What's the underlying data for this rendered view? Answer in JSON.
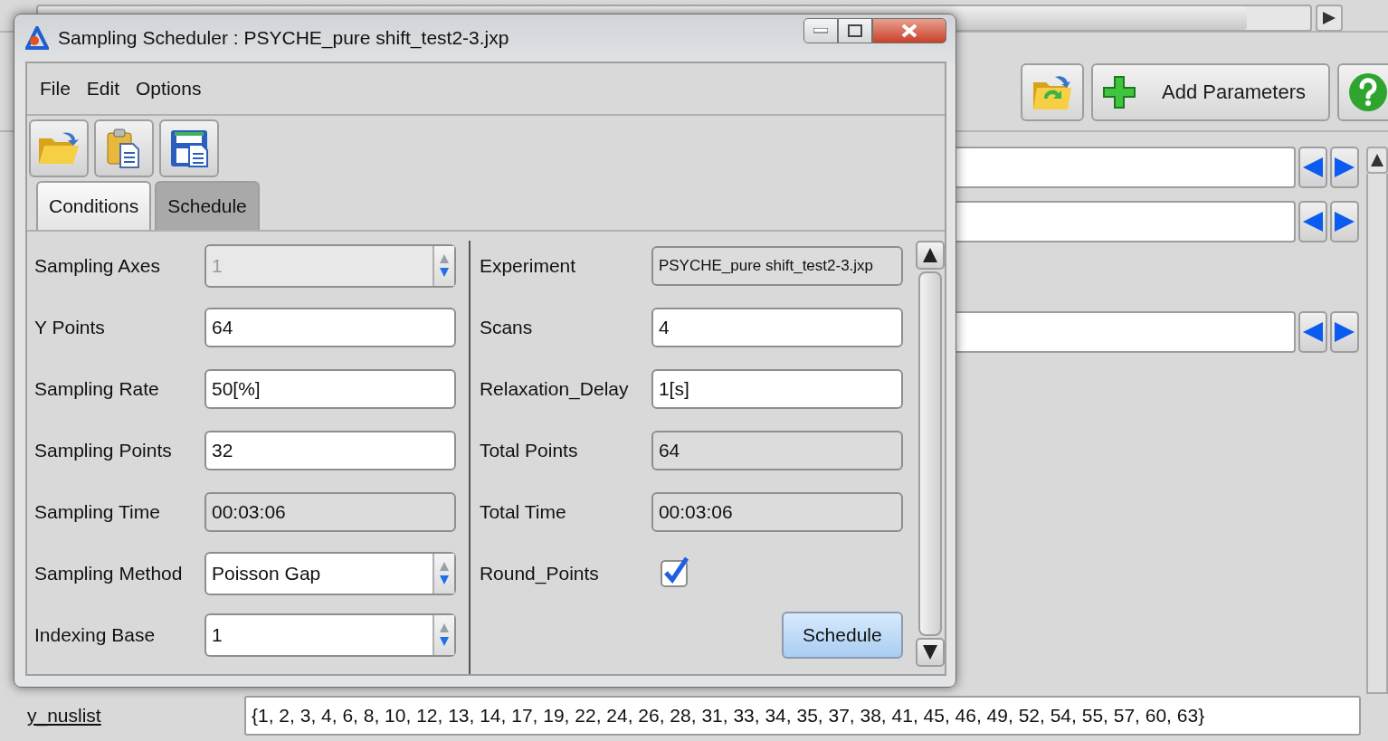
{
  "background_app": {
    "toolbar": {
      "add_button": "Add Parameters"
    },
    "nuslist": {
      "label": "y_nuslist",
      "value": "{1, 2, 3, 4, 6, 8, 10, 12, 13, 14, 17, 19, 22, 24, 26, 28, 31, 33, 34, 35, 37, 38, 41, 45, 46, 49, 52, 54, 55, 57, 60, 63}"
    }
  },
  "dialog": {
    "title": "Sampling Scheduler : PSYCHE_pure shift_test2-3.jxp",
    "menu": [
      "File",
      "Edit",
      "Options"
    ],
    "tabs": [
      {
        "label": "Conditions",
        "selected": true
      },
      {
        "label": "Schedule",
        "selected": false
      }
    ],
    "left_fields": [
      {
        "label": "Sampling Axes",
        "value": "1",
        "kind": "spin",
        "disabled": true
      },
      {
        "label": "Y Points",
        "value": "64",
        "kind": "text",
        "disabled": false
      },
      {
        "label": "Sampling Rate",
        "value": "50[%]",
        "kind": "text",
        "disabled": false
      },
      {
        "label": "Sampling Points",
        "value": "32",
        "kind": "text",
        "disabled": false
      },
      {
        "label": "Sampling Time",
        "value": "00:03:06",
        "kind": "readonly",
        "disabled": false
      },
      {
        "label": "Sampling Method",
        "value": "Poisson Gap",
        "kind": "spin",
        "disabled": false
      },
      {
        "label": "Indexing Base",
        "value": "1",
        "kind": "spin",
        "disabled": false
      }
    ],
    "right_fields": [
      {
        "label": "Experiment",
        "value": "PSYCHE_pure shift_test2-3.jxp",
        "kind": "readonly"
      },
      {
        "label": "Scans",
        "value": "4",
        "kind": "text"
      },
      {
        "label": "Relaxation_Delay",
        "value": "1[s]",
        "kind": "text"
      },
      {
        "label": "Total Points",
        "value": "64",
        "kind": "readonly"
      },
      {
        "label": "Total Time",
        "value": "00:03:06",
        "kind": "readonly"
      },
      {
        "label": "Round_Points",
        "kind": "checkbox",
        "checked": true
      }
    ],
    "schedule_button": "Schedule"
  }
}
